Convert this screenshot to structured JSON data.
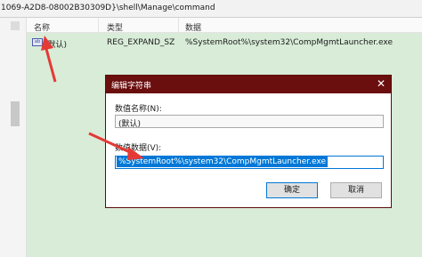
{
  "address_bar": {
    "path": "1069-A2D8-08002B30309D}\\shell\\Manage\\command"
  },
  "columns": {
    "name": "名称",
    "type": "类型",
    "data": "数据"
  },
  "registry_row": {
    "icon": "registry-value-icon",
    "icon_text": "ab",
    "name": "(默认)",
    "type": "REG_EXPAND_SZ",
    "data": "%SystemRoot%\\system32\\CompMgmtLauncher.exe"
  },
  "dialog": {
    "title": "编辑字符串",
    "close_glyph": "✕",
    "value_name_label": "数值名称(N):",
    "value_name": "(默认)",
    "value_data_label": "数值数据(V):",
    "value_data": "%SystemRoot%\\system32\\CompMgmtLauncher.exe",
    "ok_label": "确定",
    "cancel_label": "取消"
  },
  "colors": {
    "titlebar": "#6b0e0e",
    "list_background": "#d8ecd8",
    "selection": "#0078d7",
    "annotation_arrow": "#e53935"
  }
}
